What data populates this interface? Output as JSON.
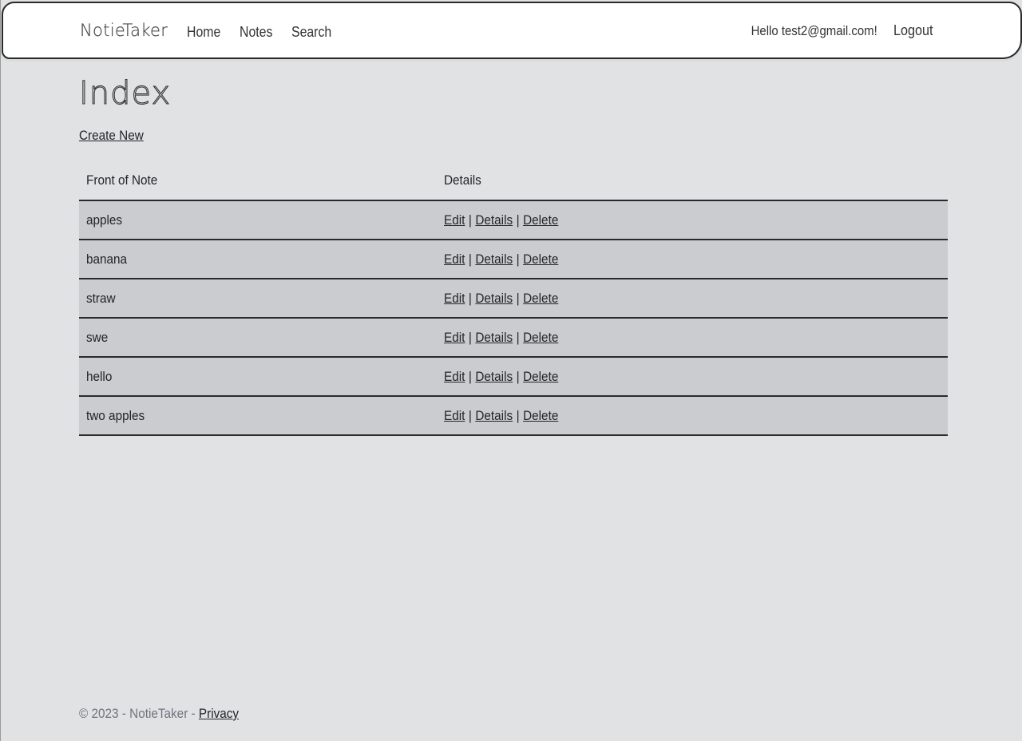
{
  "navbar": {
    "brand": "NotieTaker",
    "links": [
      {
        "label": "Home"
      },
      {
        "label": "Notes"
      },
      {
        "label": "Search"
      }
    ],
    "greeting": "Hello test2@gmail.com!",
    "logout_label": "Logout"
  },
  "page": {
    "title": "Index",
    "create_new_label": "Create New"
  },
  "table": {
    "headers": [
      "Front of Note",
      "Details"
    ],
    "rows": [
      {
        "front": "apples"
      },
      {
        "front": "banana"
      },
      {
        "front": "straw"
      },
      {
        "front": "swe"
      },
      {
        "front": "hello"
      },
      {
        "front": "two apples"
      }
    ],
    "actions": {
      "edit": "Edit",
      "details": "Details",
      "delete": "Delete",
      "separator": "|"
    }
  },
  "footer": {
    "copyright": "© 2023 - NotieTaker -",
    "privacy_label": "Privacy"
  }
}
